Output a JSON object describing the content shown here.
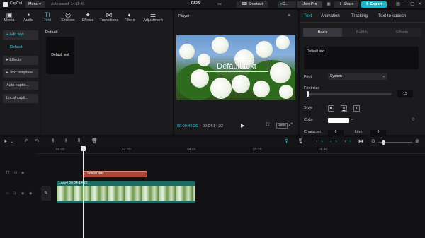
{
  "titlebar": {
    "app_name": "CapCut",
    "menu_label": "Menu",
    "autosave": "Auto saved: 14:11:49",
    "project_title": "0829",
    "shortcut_label": "Shortcut",
    "user_label": "C...",
    "join_pro_label": "Join Pro",
    "share_label": "Share",
    "export_label": "Export"
  },
  "toolbar_tabs": [
    {
      "label": "Media",
      "icon": "media-icon"
    },
    {
      "label": "Audio",
      "icon": "audio-icon"
    },
    {
      "label": "Text",
      "icon": "text-icon",
      "active": true
    },
    {
      "label": "Stickers",
      "icon": "stickers-icon"
    },
    {
      "label": "Effects",
      "icon": "effects-icon"
    },
    {
      "label": "Transitions",
      "icon": "transitions-icon"
    },
    {
      "label": "Filters",
      "icon": "filters-icon"
    },
    {
      "label": "Adjustment",
      "icon": "adjustment-icon"
    }
  ],
  "side_menu": {
    "add_text": "+ Add text",
    "default": "Default",
    "effects": "▸ Effects",
    "text_template": "▸ Text template",
    "auto_caption": "Auto captio...",
    "local_caption": "Local capti..."
  },
  "text_panel": {
    "section_label": "Default",
    "card_text": "Default text"
  },
  "player": {
    "title": "Player",
    "overlay_text": "Default text",
    "current_time": "00:00:49:26",
    "total_time": "00:04:14:22",
    "ratio_label": "Ratio"
  },
  "inspector": {
    "tabs": [
      "Text",
      "Animation",
      "Tracking",
      "Text-to-speech"
    ],
    "subtabs": [
      "Basic",
      "Bubble",
      "Effects"
    ],
    "text_value": "Default text",
    "font_label": "Font",
    "font_value": "System",
    "font_size_label": "Font size",
    "font_size_value": "15",
    "style_label": "Style",
    "bold": "B",
    "underline": "U",
    "italic": "I",
    "color_label": "Color",
    "color_value": "#ffffff",
    "character_label": "Character",
    "character_value": "0",
    "line_label": "Line",
    "line_value": "0"
  },
  "timeline": {
    "ruler_labels": [
      "00:00",
      "02:30",
      "04:00",
      "05:00",
      "06:40"
    ],
    "text_clip_label": "Default text",
    "video_clip_label": "1.mp4   00:04:14:22",
    "accent_color": "#1cd0e0"
  }
}
